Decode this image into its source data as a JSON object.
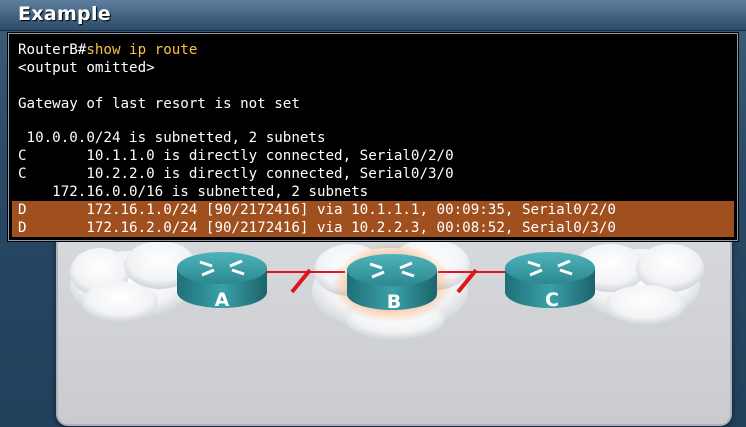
{
  "window": {
    "title": "Example"
  },
  "terminal": {
    "prompt": "RouterB#",
    "command": "show ip route",
    "lines": [
      "<output omitted>",
      "",
      "Gateway of last resort is not set",
      "",
      " 10.0.0.0/24 is subnetted, 2 subnets",
      "C       10.1.1.0 is directly connected, Serial0/2/0",
      "C       10.2.2.0 is directly connected, Serial0/3/0",
      "    172.16.0.0/16 is subnetted, 2 subnets"
    ],
    "highlighted": [
      "D       172.16.1.0/24 [90/2172416] via 10.1.1.1, 00:09:35, Serial0/2/0",
      "D       172.16.2.0/24 [90/2172416] via 10.2.2.3, 00:08:52, Serial0/3/0"
    ],
    "highlight_color": "#a0501e",
    "command_color": "#f5c242"
  },
  "diagram": {
    "routers": [
      {
        "label": "A"
      },
      {
        "label": "B"
      },
      {
        "label": "C"
      }
    ],
    "focus_router": "B",
    "link_color": "#e0141a",
    "router_color": "#2e8d95"
  }
}
